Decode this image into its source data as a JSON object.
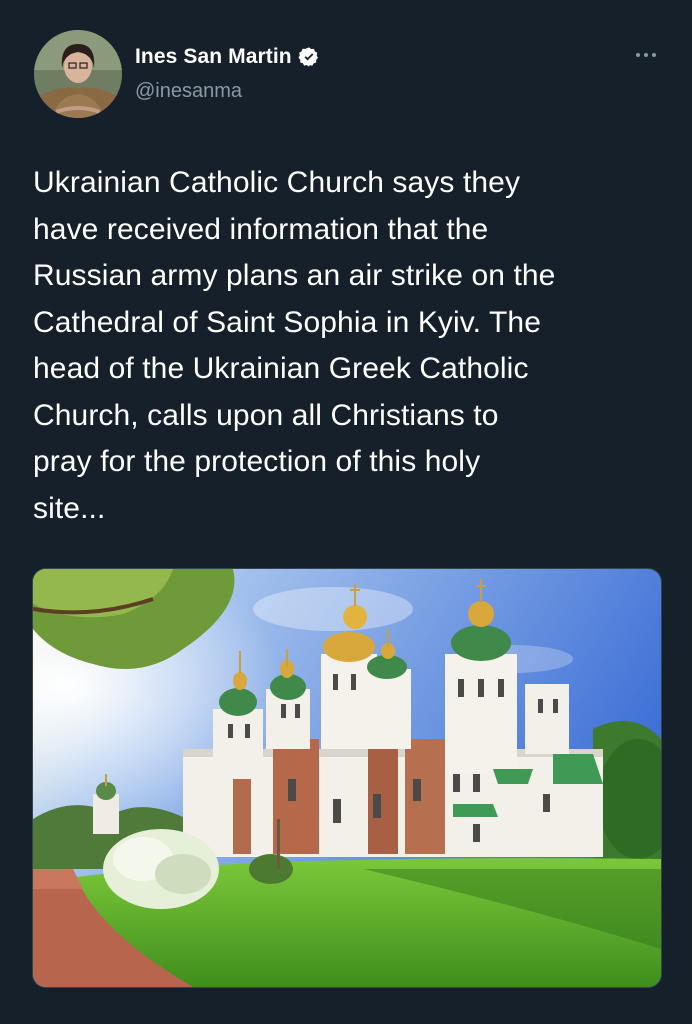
{
  "author": {
    "name": "Ines San Martin",
    "handle": "@inesanma",
    "verified": true
  },
  "tweet": {
    "text": "Ukrainian Catholic Church says they\nhave received information that the\nRussian army plans an air strike on the\nCathedral of Saint Sophia in Kyiv. The\nhead  of the Ukrainian Greek Catholic\nChurch, calls upon all Christians to\npray for the protection of this holy\nsite..."
  },
  "icons": {
    "more": "more-options-icon",
    "verified": "verified-badge-icon"
  },
  "colors": {
    "background": "#15202b",
    "text": "#ffffff",
    "secondary_text": "#8b98a5",
    "verified_badge": "#ffffff"
  }
}
